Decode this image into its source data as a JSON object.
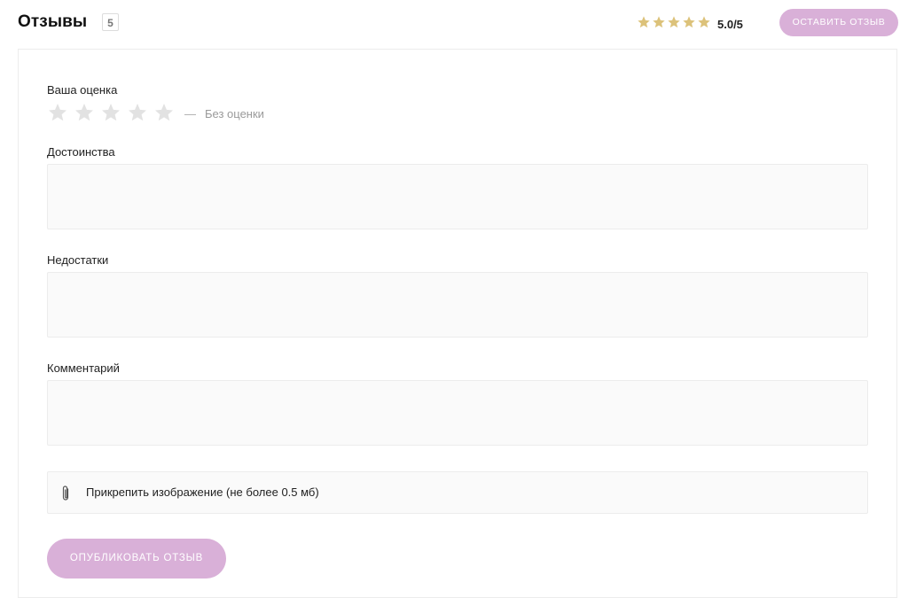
{
  "header": {
    "title": "Отзывы",
    "count": "5",
    "average_rating": 5.0,
    "average_rating_text": "5.0/5",
    "leave_review_label": "ОСТАВИТЬ ОТЗЫВ"
  },
  "form": {
    "rating_label": "Ваша оценка",
    "rating_dash": "—",
    "rating_status": "Без оценки",
    "rating_value": 0,
    "rating_max": 5,
    "pros_label": "Достоинства",
    "pros_value": "",
    "cons_label": "Недостатки",
    "cons_value": "",
    "comment_label": "Комментарий",
    "comment_value": "",
    "attach_label": "Прикрепить изображение (не более 0.5 мб)",
    "publish_label": "ОПУБЛИКОВАТЬ ОТЗЫВ"
  },
  "icons": {
    "star": "star-icon",
    "attach": "paperclip-icon"
  },
  "colors": {
    "accent": "#d9b0d8",
    "star_filled": "#dcc27a",
    "star_empty": "#e2e2e2",
    "field_bg": "#fafafa"
  }
}
